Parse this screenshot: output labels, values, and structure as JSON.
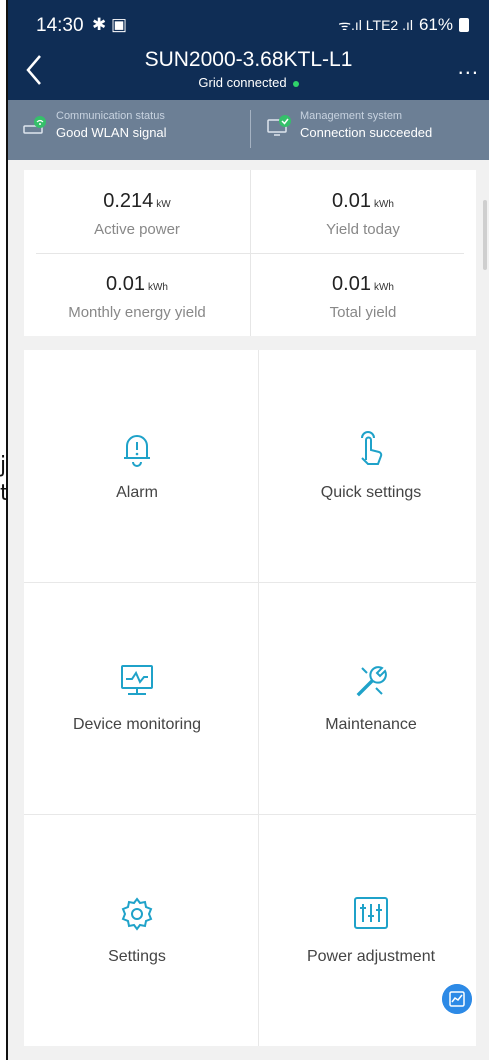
{
  "status_bar": {
    "time": "14:30",
    "icons_left": "✱ ▣",
    "network": "ᯤ.ıl LTE2 .ıl",
    "battery": "61%"
  },
  "header": {
    "title": "SUN2000-3.68KTL-L1",
    "subtitle": "Grid connected",
    "more": "..."
  },
  "communication": {
    "label": "Communication status",
    "value": "Good WLAN signal"
  },
  "management": {
    "label": "Management system",
    "value": "Connection succeeded"
  },
  "stats": [
    {
      "value": "0.214",
      "unit": "kW",
      "caption": "Active power"
    },
    {
      "value": "0.01",
      "unit": "kWh",
      "caption": "Yield today"
    },
    {
      "value": "0.01",
      "unit": "kWh",
      "caption": "Monthly energy yield"
    },
    {
      "value": "0.01",
      "unit": "kWh",
      "caption": "Total yield"
    }
  ],
  "tiles": [
    {
      "label": "Alarm",
      "icon": "alarm-bell-icon"
    },
    {
      "label": "Quick settings",
      "icon": "hand-tap-icon"
    },
    {
      "label": "Device monitoring",
      "icon": "monitor-chart-icon"
    },
    {
      "label": "Maintenance",
      "icon": "wrench-icon"
    },
    {
      "label": "Settings",
      "icon": "gear-icon"
    },
    {
      "label": "Power adjustment",
      "icon": "sliders-icon"
    }
  ],
  "colors": {
    "header": "#0f2d55",
    "comm_bar": "#6c7f95",
    "accent": "#2d8ae6",
    "ok_green": "#2fd36a"
  },
  "bleed_text": "j\nt',"
}
